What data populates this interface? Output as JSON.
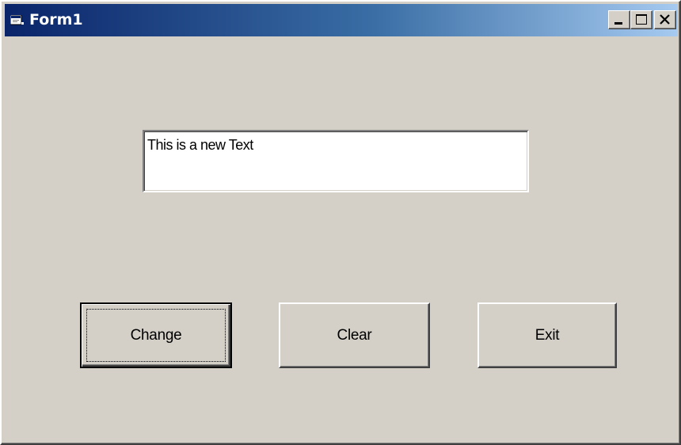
{
  "window": {
    "title": "Form1",
    "icon": "form-icon",
    "caption_buttons": [
      "minimize-icon",
      "maximize-icon",
      "close-icon"
    ]
  },
  "textbox": {
    "value": "This is a new Text"
  },
  "buttons": {
    "change_label": "Change",
    "clear_label": "Clear",
    "exit_label": "Exit"
  },
  "colors": {
    "face": "#d4d0c8",
    "title_start": "#0a246a",
    "title_end": "#a6caf0",
    "title_text": "#ffffff"
  }
}
